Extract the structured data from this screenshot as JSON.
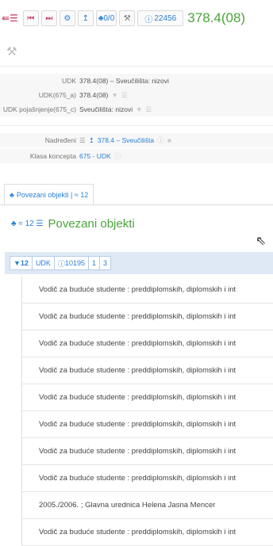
{
  "toolbar": {
    "back_icon": "back-list-icon",
    "buttons": [
      "first-icon",
      "prev-icon",
      "settings-icon",
      "up-icon",
      "tree-icon",
      "hammer-icon"
    ],
    "tree_label": "0/0",
    "info_count": "22456",
    "title": "378.4(08)"
  },
  "details": {
    "udk_label": "UDK",
    "udk_value": "378.4(08) – Sveučilišta: nizovi",
    "udk675a_label": "UDK(675_a)",
    "udk675a_value": "378.4(08)",
    "udk675c_label": "UDK pojašnjenje(675_c)",
    "udk675c_value": "Sveučilišta: nizovi",
    "parent_label": "Nadređeni",
    "parent_value": "378.4 – Sveučilišta",
    "class_label": "Klasa koncepta",
    "class_value": "675 - UDK"
  },
  "tab": {
    "label": "Povezani objekti | ≈ 12"
  },
  "section": {
    "meta": "≈ 12",
    "title": "Povezani objekti"
  },
  "filters": {
    "count": "12",
    "type": "UDK",
    "info": "10195",
    "page": "1",
    "pages": "3"
  },
  "results": [
    "Vodič za buduće studente : preddiplomskih, diplomskih i int",
    "Vodič za buduće studente : preddiplomskih, diplomskih i int",
    "Vodič za buduće studente : preddiplomskih, diplomskih i int",
    "Vodič za buduće studente : preddiplomskih, diplomskih i int",
    "Vodič za buduće studente : preddiplomskih, diplomskih i int",
    "Vodič za buduće studente : preddiplomskih, diplomskih i int",
    "Vodič za buduće studente : preddiplomskih, diplomskih i int",
    "Vodič za buduće studente : preddiplomskih, diplomskih i int",
    "2005./2006. ; Glavna urednica Helena Jasna Mencer",
    "Vodič za buduće studente : preddiplomskih, diplomskih i int"
  ]
}
